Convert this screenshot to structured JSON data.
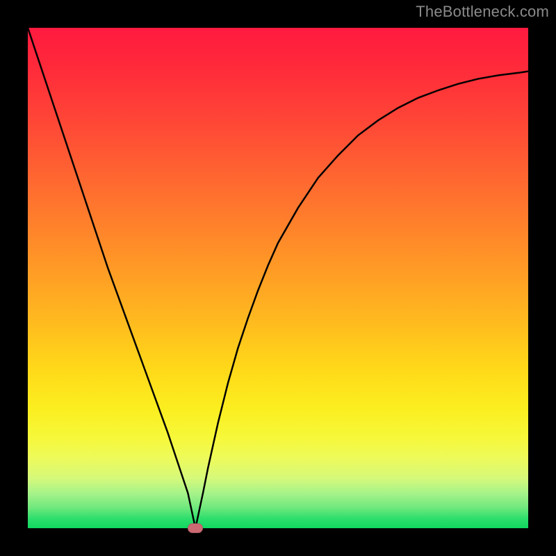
{
  "attribution": "TheBottleneck.com",
  "colors": {
    "page_bg": "#000000",
    "attribution_text": "#8a8a8a",
    "curve_stroke": "#000000",
    "marker_fill": "#cc6a74",
    "gradient_stops": [
      "#ff1a3f",
      "#ff2a3a",
      "#ff4a36",
      "#ff6f2f",
      "#ff9427",
      "#ffb81f",
      "#ffd819",
      "#fbee1f",
      "#f6f83a",
      "#edfa5a",
      "#d6f97a",
      "#a7f38a",
      "#6de87d",
      "#2fde6d",
      "#0fd860"
    ]
  },
  "chart_data": {
    "type": "line",
    "title": "",
    "xlabel": "",
    "ylabel": "",
    "x": [
      0.0,
      0.02,
      0.04,
      0.06,
      0.08,
      0.1,
      0.12,
      0.14,
      0.16,
      0.18,
      0.2,
      0.22,
      0.24,
      0.26,
      0.28,
      0.3,
      0.32,
      0.335,
      0.35,
      0.36,
      0.38,
      0.4,
      0.42,
      0.44,
      0.46,
      0.48,
      0.5,
      0.54,
      0.58,
      0.62,
      0.66,
      0.7,
      0.74,
      0.78,
      0.82,
      0.86,
      0.9,
      0.94,
      0.98,
      1.0
    ],
    "values": [
      100,
      94,
      88,
      82,
      76,
      70,
      64,
      58,
      52,
      46.5,
      41,
      35.5,
      30,
      24.5,
      19,
      13,
      7,
      0,
      7,
      12,
      21,
      29,
      36,
      42,
      47.5,
      52.5,
      57,
      64,
      70,
      74.5,
      78.5,
      81.5,
      84,
      86,
      87.5,
      88.8,
      89.8,
      90.5,
      91,
      91.3
    ],
    "xlim": [
      0,
      1
    ],
    "ylim": [
      0,
      100
    ],
    "minimum_marker": {
      "x": 0.335,
      "y": 0
    },
    "grid": false,
    "legend": false
  }
}
